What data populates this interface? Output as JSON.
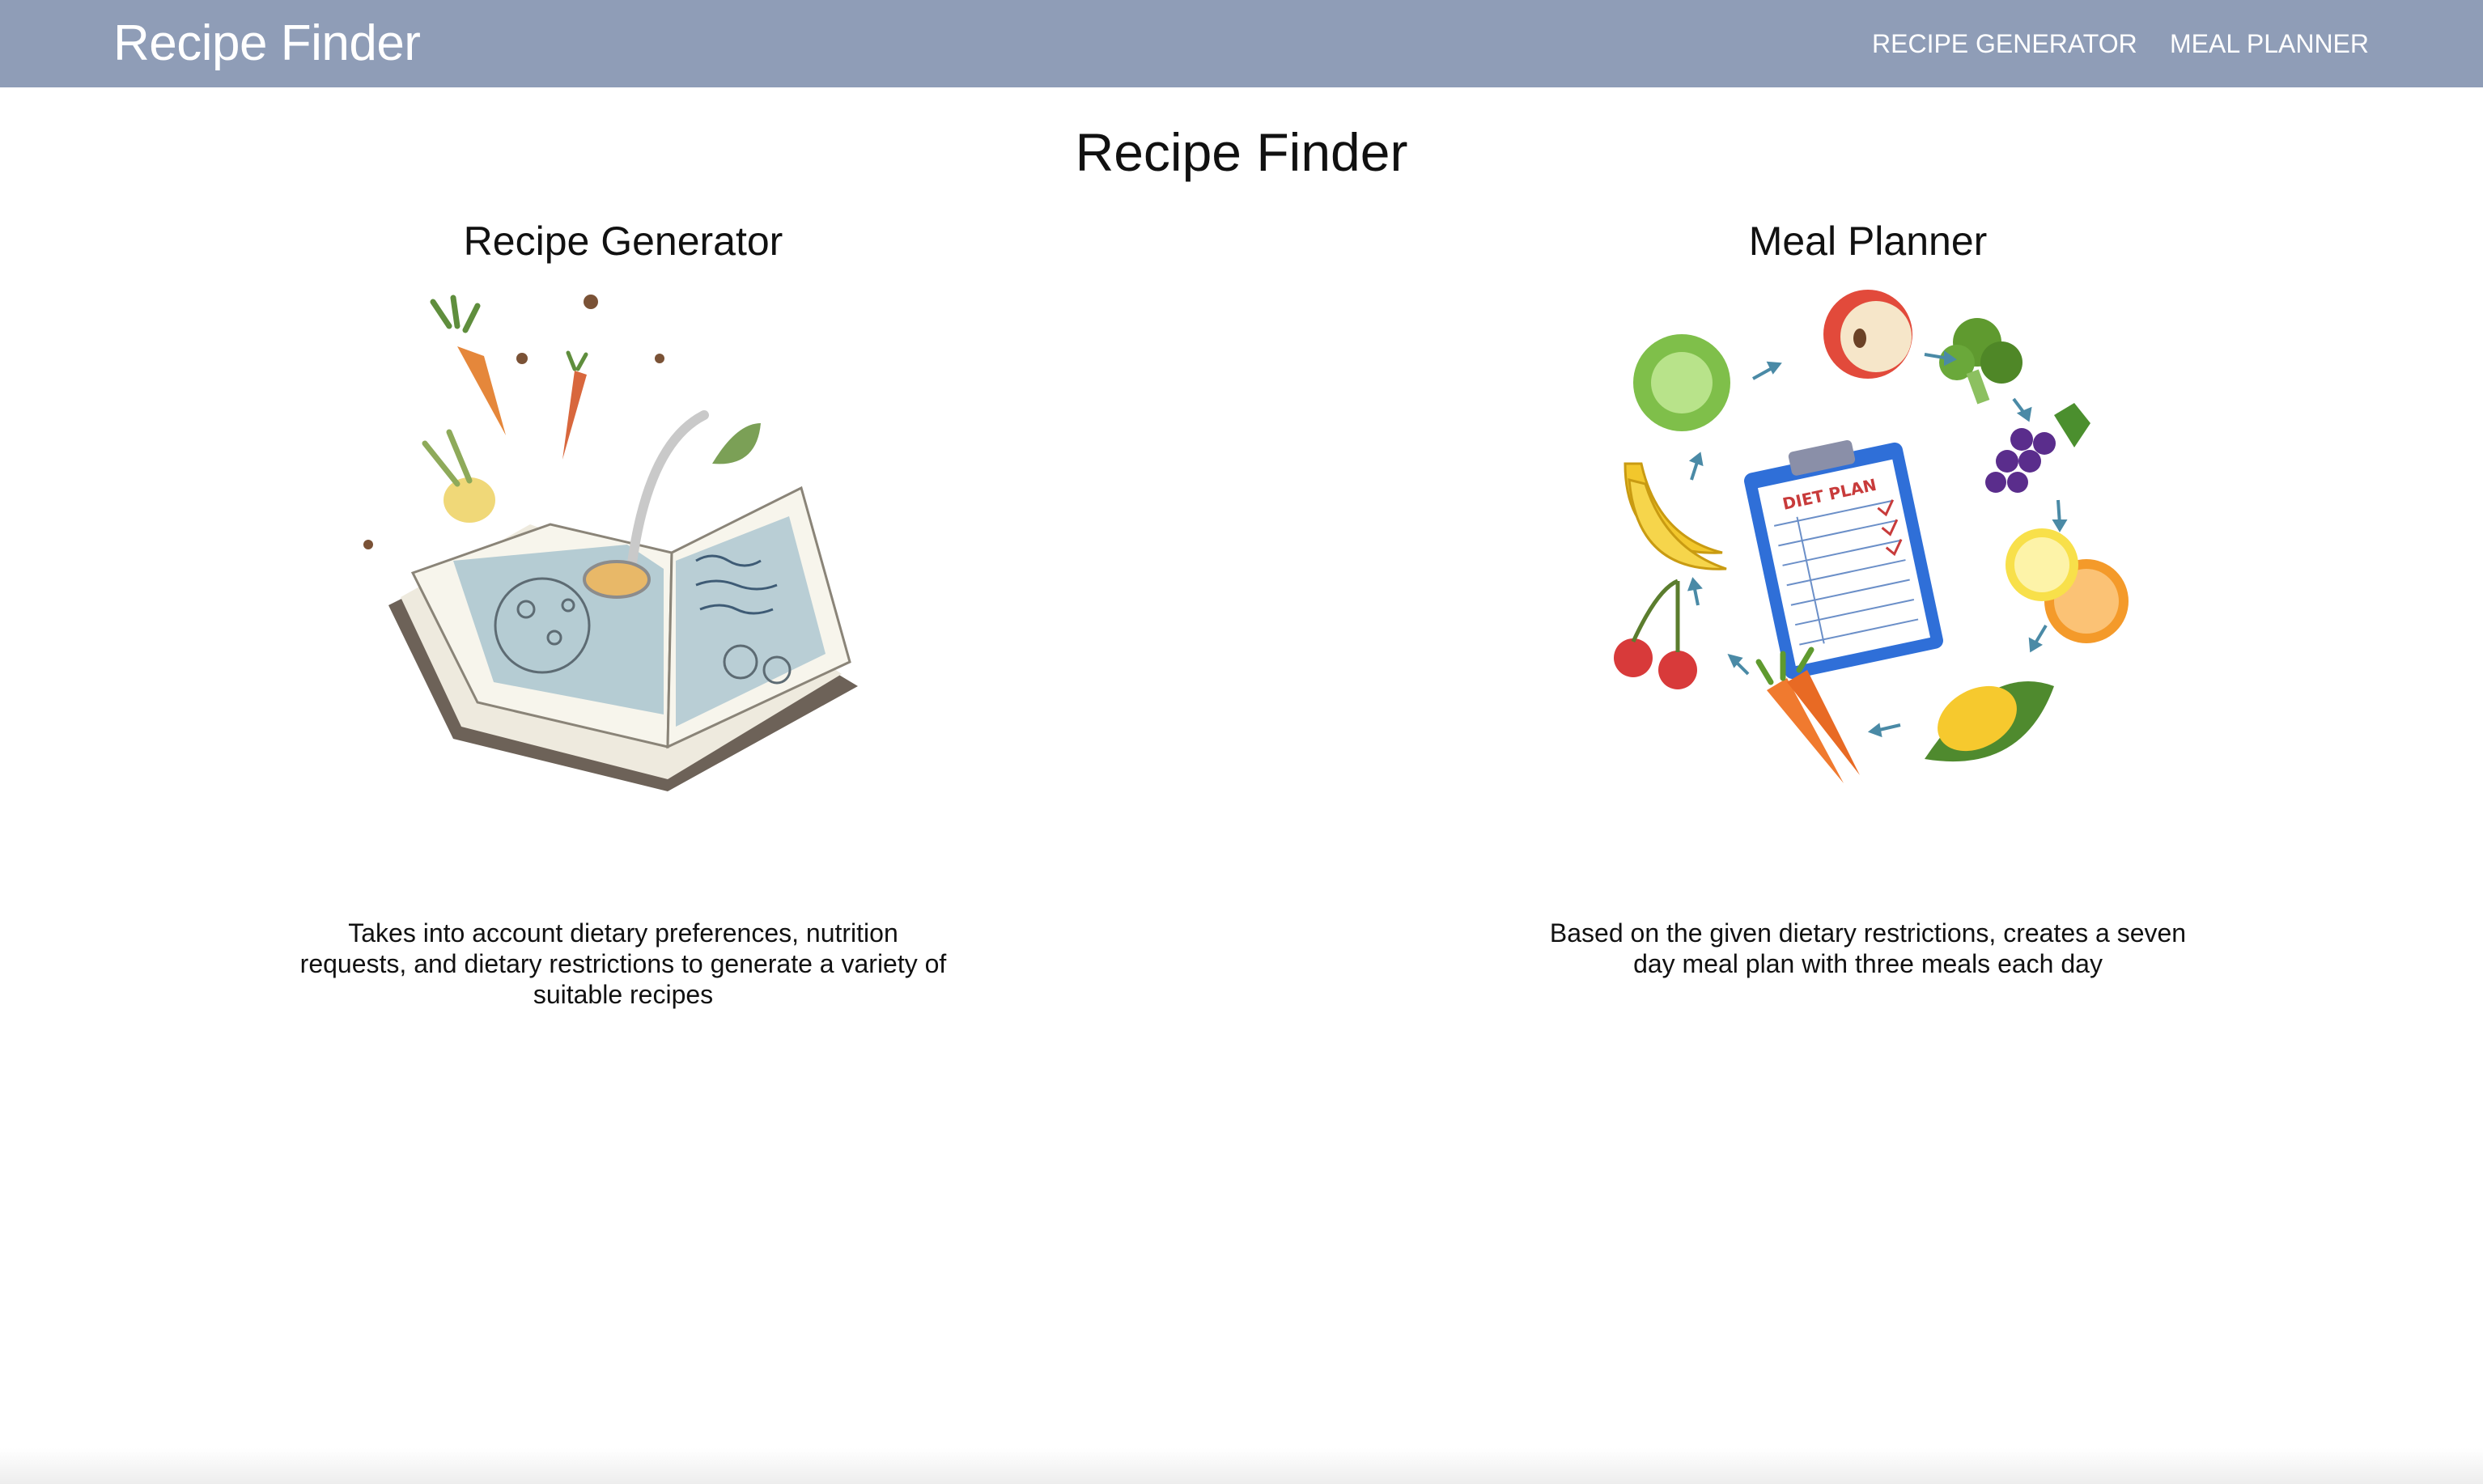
{
  "navbar": {
    "brand": "Recipe Finder",
    "links": [
      {
        "label": "RECIPE GENERATOR"
      },
      {
        "label": "MEAL PLANNER"
      }
    ]
  },
  "main": {
    "title": "Recipe Finder",
    "cards": [
      {
        "title": "Recipe Generator",
        "illustration": "recipe-book-illustration",
        "description": "Takes into account dietary preferences, nutrition requests, and dietary restrictions to generate a variety of suitable recipes"
      },
      {
        "title": "Meal Planner",
        "illustration": "diet-plan-illustration",
        "clipboard_label": "DIET PLAN",
        "description": "Based on the given dietary restrictions, creates a seven day meal plan with three meals each day"
      }
    ]
  },
  "colors": {
    "navbar": "#8f9db7",
    "nav_text": "#ffffff",
    "page_text": "#111111"
  }
}
